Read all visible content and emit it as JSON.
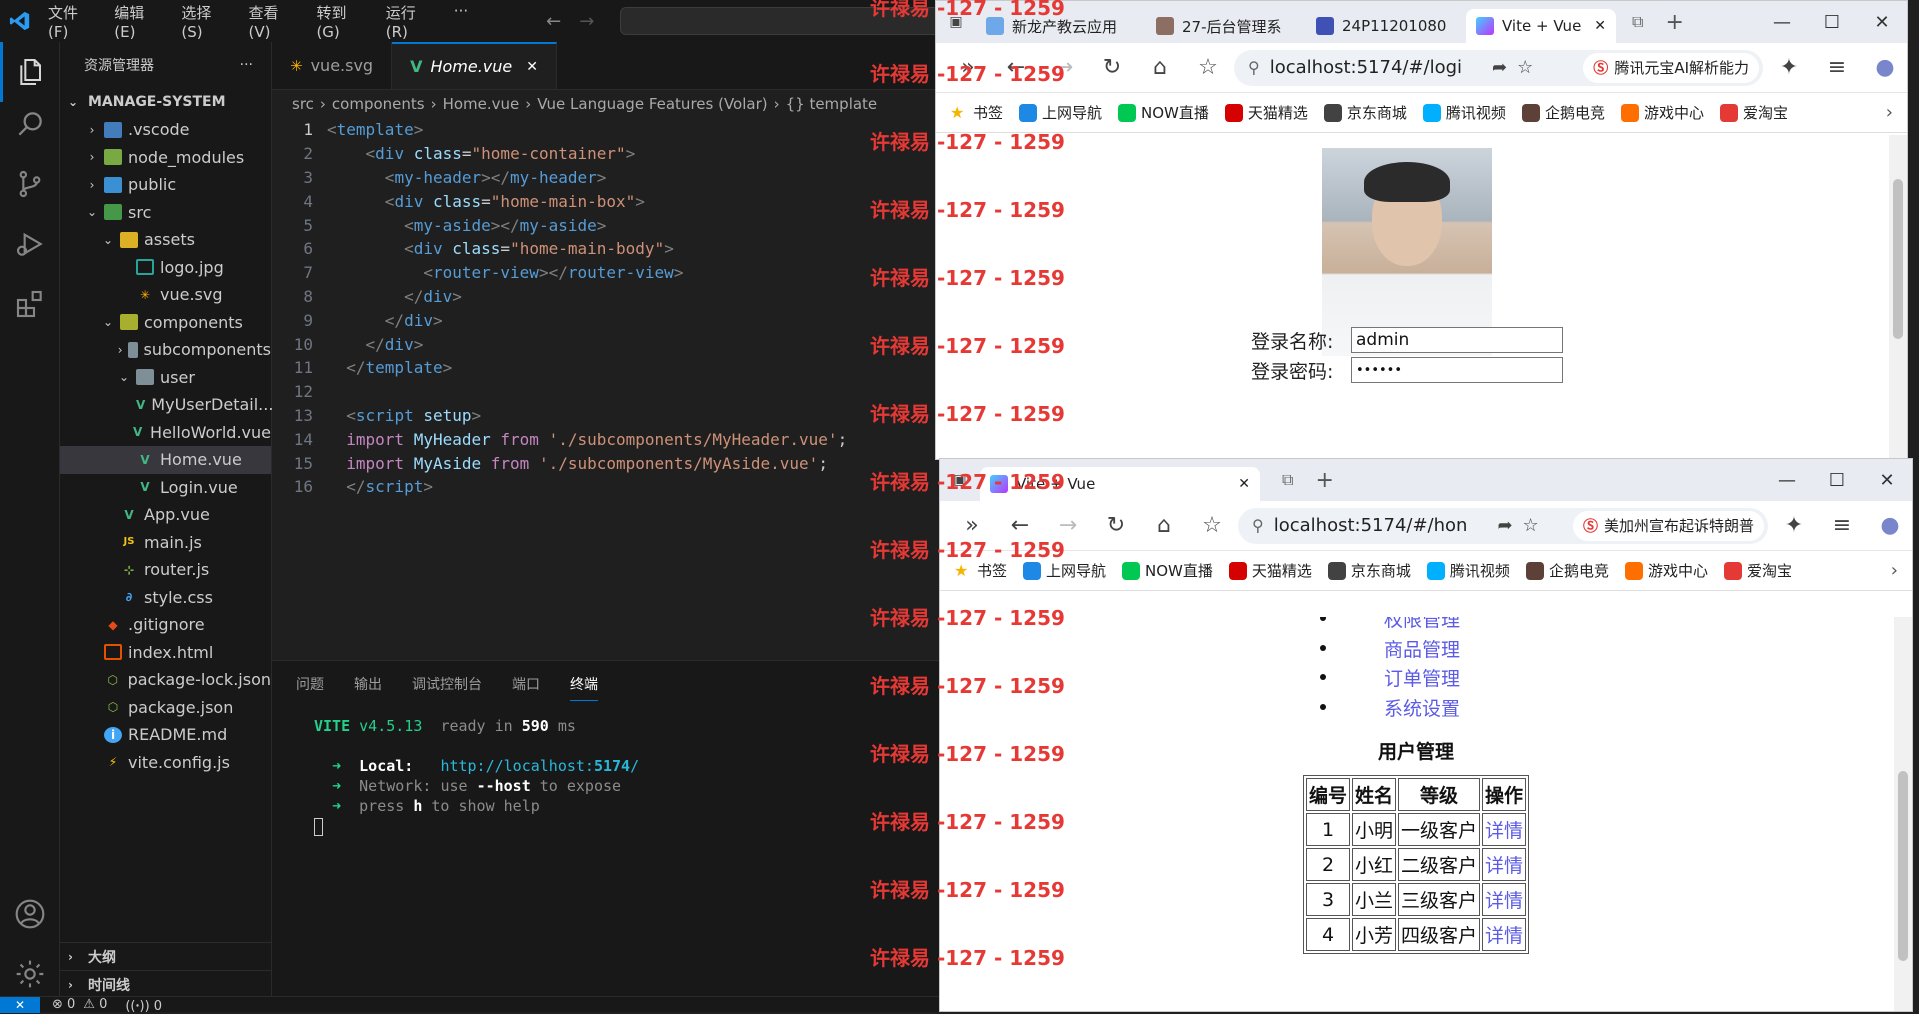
{
  "vscode": {
    "menu": [
      "文件(F)",
      "编辑(E)",
      "选择(S)",
      "查看(V)",
      "转到(G)",
      "运行(R)",
      "···"
    ],
    "explorer_title": "资源管理器",
    "explorer_more": "···",
    "root": "MANAGE-SYSTEM",
    "tree": [
      {
        "label": ".vscode",
        "chev": "›",
        "icon": "vscode-folder-icon",
        "color": "#4b8ed8"
      },
      {
        "label": "node_modules",
        "chev": "›",
        "icon": "node-folder-icon",
        "color": "#8bc34a"
      },
      {
        "label": "public",
        "chev": "›",
        "icon": "public-folder-icon",
        "color": "#42a5f5"
      },
      {
        "label": "src",
        "chev": "⌄",
        "icon": "src-folder-icon",
        "color": "#4caf50"
      },
      {
        "label": "assets",
        "chev": "⌄",
        "icon": "assets-folder-icon",
        "color": "#ffca28"
      },
      {
        "label": "logo.jpg",
        "chev": "",
        "icon": "image-file-icon",
        "color": "#26a69a"
      },
      {
        "label": "vue.svg",
        "chev": "",
        "icon": "svg-file-icon",
        "color": "#ffb300"
      },
      {
        "label": "components",
        "chev": "⌄",
        "icon": "components-folder-icon",
        "color": "#c0ca33"
      },
      {
        "label": "subcomponents",
        "chev": "›",
        "icon": "folder-icon",
        "color": "#90a4ae"
      },
      {
        "label": "user",
        "chev": "⌄",
        "icon": "folder-icon",
        "color": "#90a4ae"
      },
      {
        "label": "MyUserDetail...",
        "chev": "",
        "icon": "vue-file-icon",
        "color": "#41b883"
      },
      {
        "label": "HelloWorld.vue",
        "chev": "",
        "icon": "vue-file-icon",
        "color": "#41b883"
      },
      {
        "label": "Home.vue",
        "chev": "",
        "icon": "vue-file-icon",
        "color": "#41b883"
      },
      {
        "label": "Login.vue",
        "chev": "",
        "icon": "vue-file-icon",
        "color": "#41b883"
      },
      {
        "label": "App.vue",
        "chev": "",
        "icon": "vue-file-icon",
        "color": "#41b883"
      },
      {
        "label": "main.js",
        "chev": "",
        "icon": "js-file-icon",
        "color": "#f1c40f"
      },
      {
        "label": "router.js",
        "chev": "",
        "icon": "router-file-icon",
        "color": "#8bc34a"
      },
      {
        "label": "style.css",
        "chev": "",
        "icon": "css-file-icon",
        "color": "#42a5f5"
      },
      {
        "label": ".gitignore",
        "chev": "",
        "icon": "git-file-icon",
        "color": "#e64a19"
      },
      {
        "label": "index.html",
        "chev": "",
        "icon": "html-file-icon",
        "color": "#e65100"
      },
      {
        "label": "package-lock.json",
        "chev": "",
        "icon": "npm-file-icon",
        "color": "#8bc34a"
      },
      {
        "label": "package.json",
        "chev": "",
        "icon": "npm-file-icon",
        "color": "#8bc34a"
      },
      {
        "label": "README.md",
        "chev": "",
        "icon": "info-file-icon",
        "color": "#42a5f5"
      },
      {
        "label": "vite.config.js",
        "chev": "",
        "icon": "vite-file-icon",
        "color": "#ffc107"
      }
    ],
    "outline": "大纲",
    "timeline": "时间线",
    "tabs": [
      {
        "label": "vue.svg",
        "icon": "svg-file-icon"
      },
      {
        "label": "Home.vue",
        "icon": "vue-file-icon"
      }
    ],
    "tab_close": "✕",
    "breadcrumb": [
      "src",
      "›",
      "components",
      "›",
      "Home.vue",
      "›",
      "Vue Language Features (Volar)",
      "›",
      "{} template"
    ],
    "code_lines": [
      [
        [
          "tk-punc",
          "<"
        ],
        [
          "tk-tag",
          "template"
        ],
        [
          "tk-punc",
          ">"
        ]
      ],
      [
        [
          "",
          "    "
        ],
        [
          "tk-punc",
          "<"
        ],
        [
          "tk-tag",
          "div"
        ],
        [
          "",
          " "
        ],
        [
          "tk-attr",
          "class"
        ],
        [
          "",
          "="
        ],
        [
          "tk-str",
          "\"home-container\""
        ],
        [
          "tk-punc",
          ">"
        ]
      ],
      [
        [
          "",
          "      "
        ],
        [
          "tk-punc",
          "<"
        ],
        [
          "tk-tag",
          "my-header"
        ],
        [
          "tk-punc",
          "></"
        ],
        [
          "tk-tag",
          "my-header"
        ],
        [
          "tk-punc",
          ">"
        ]
      ],
      [
        [
          "",
          "      "
        ],
        [
          "tk-punc",
          "<"
        ],
        [
          "tk-tag",
          "div"
        ],
        [
          "",
          " "
        ],
        [
          "tk-attr",
          "class"
        ],
        [
          "",
          "="
        ],
        [
          "tk-str",
          "\"home-main-box\""
        ],
        [
          "tk-punc",
          ">"
        ]
      ],
      [
        [
          "",
          "        "
        ],
        [
          "tk-punc",
          "<"
        ],
        [
          "tk-tag",
          "my-aside"
        ],
        [
          "tk-punc",
          "></"
        ],
        [
          "tk-tag",
          "my-aside"
        ],
        [
          "tk-punc",
          ">"
        ]
      ],
      [
        [
          "",
          "        "
        ],
        [
          "tk-punc",
          "<"
        ],
        [
          "tk-tag",
          "div"
        ],
        [
          "",
          " "
        ],
        [
          "tk-attr",
          "class"
        ],
        [
          "",
          "="
        ],
        [
          "tk-str",
          "\"home-main-body\""
        ],
        [
          "tk-punc",
          ">"
        ]
      ],
      [
        [
          "",
          "          "
        ],
        [
          "tk-punc",
          "<"
        ],
        [
          "tk-tag",
          "router-view"
        ],
        [
          "tk-punc",
          "></"
        ],
        [
          "tk-tag",
          "router-view"
        ],
        [
          "tk-punc",
          ">"
        ]
      ],
      [
        [
          "",
          "        "
        ],
        [
          "tk-punc",
          "</"
        ],
        [
          "tk-tag",
          "div"
        ],
        [
          "tk-punc",
          ">"
        ]
      ],
      [
        [
          "",
          "      "
        ],
        [
          "tk-punc",
          "</"
        ],
        [
          "tk-tag",
          "div"
        ],
        [
          "tk-punc",
          ">"
        ]
      ],
      [
        [
          "",
          "    "
        ],
        [
          "tk-punc",
          "</"
        ],
        [
          "tk-tag",
          "div"
        ],
        [
          "tk-punc",
          ">"
        ]
      ],
      [
        [
          "",
          "  "
        ],
        [
          "tk-punc",
          "</"
        ],
        [
          "tk-tag",
          "template"
        ],
        [
          "tk-punc",
          ">"
        ]
      ],
      [],
      [
        [
          "",
          "  "
        ],
        [
          "tk-punc",
          "<"
        ],
        [
          "tk-tag",
          "script"
        ],
        [
          "",
          " "
        ],
        [
          "tk-attr",
          "setup"
        ],
        [
          "tk-punc",
          ">"
        ]
      ],
      [
        [
          "",
          "  "
        ],
        [
          "tk-kw",
          "import"
        ],
        [
          "",
          " "
        ],
        [
          "tk-id",
          "MyHeader"
        ],
        [
          "",
          " "
        ],
        [
          "tk-kw",
          "from"
        ],
        [
          "",
          " "
        ],
        [
          "tk-str",
          "'./subcomponents/MyHeader.vue'"
        ],
        [
          "",
          ";"
        ]
      ],
      [
        [
          "",
          "  "
        ],
        [
          "tk-kw",
          "import"
        ],
        [
          "",
          " "
        ],
        [
          "tk-id",
          "MyAside"
        ],
        [
          "",
          " "
        ],
        [
          "tk-kw",
          "from"
        ],
        [
          "",
          " "
        ],
        [
          "tk-str",
          "'./subcomponents/MyAside.vue'"
        ],
        [
          "",
          ";"
        ]
      ],
      [
        [
          "",
          "  "
        ],
        [
          "tk-punc",
          "</"
        ],
        [
          "tk-tag",
          "script"
        ],
        [
          "tk-punc",
          ">"
        ]
      ]
    ],
    "panel_tabs": [
      "问题",
      "输出",
      "调试控制台",
      "端口",
      "终端"
    ],
    "terminal": {
      "vite": "VITE",
      "version": "v4.5.13",
      "ready": "ready in",
      "ms_value": "590",
      "ms": "ms",
      "arrow": "➜",
      "local_label": "Local:",
      "local_url_pre": "http://localhost:",
      "local_port": "5174",
      "local_url_post": "/",
      "network_label": "Network:",
      "network_text": "use",
      "host_flag": "--host",
      "network_tail": "to expose",
      "press": "press",
      "h": "h",
      "help": "to show help"
    },
    "status": {
      "remote": "✕",
      "errors": "⊗ 0",
      "warnings": "⚠ 0",
      "ports": "((ꞏ)) 0"
    }
  },
  "watermark": "许禄易 -127 - 1259",
  "browser1": {
    "tabs": [
      "新龙产教云应用",
      "27-后台管理系",
      "24P11201080",
      "Vite + Vue"
    ],
    "url": "localhost:5174/#/logi",
    "ai_text": "腾讯元宝AI解析能力",
    "bookmarks": [
      "书签",
      "上网导航",
      "NOW直播",
      "天猫精选",
      "京东商城",
      "腾讯视频",
      "企鹅电竞",
      "游戏中心",
      "爱淘宝"
    ],
    "login_name_label": "登录名称:",
    "login_name_value": "admin",
    "login_pwd_label": "登录密码:",
    "login_pwd_value": "••••••"
  },
  "browser2": {
    "tab": "Vite + Vue",
    "url": "localhost:5174/#/hon",
    "ai_text": "美加州宣布起诉特朗普",
    "bookmarks": [
      "书签",
      "上网导航",
      "NOW直播",
      "天猫精选",
      "京东商城",
      "腾讯视频",
      "企鹅电竞",
      "游戏中心",
      "爱淘宝"
    ],
    "menu": [
      "权限管理",
      "商品管理",
      "订单管理",
      "系统设置"
    ],
    "heading": "用户管理",
    "table": {
      "headers": [
        "编号",
        "姓名",
        "等级",
        "操作"
      ],
      "rows": [
        [
          "1",
          "小明",
          "一级客户",
          "详情"
        ],
        [
          "2",
          "小红",
          "二级客户",
          "详情"
        ],
        [
          "3",
          "小兰",
          "三级客户",
          "详情"
        ],
        [
          "4",
          "小芳",
          "四级客户",
          "详情"
        ]
      ]
    }
  },
  "colors": {
    "accent": "#0078d4",
    "vue_green": "#41b883",
    "link": "#5b5be6",
    "watermark": "#e53935"
  }
}
